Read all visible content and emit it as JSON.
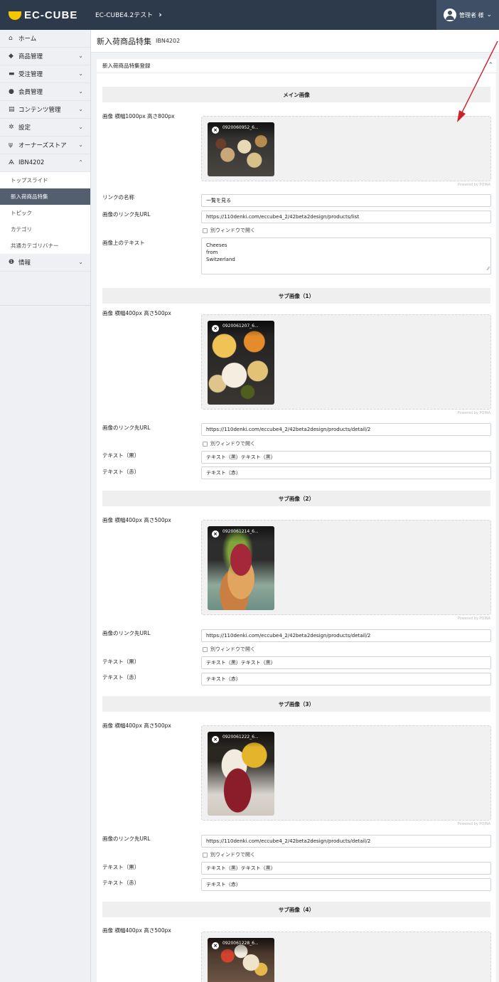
{
  "header": {
    "logo": "EC-CUBE",
    "shop_name": "EC-CUBE4.2テスト",
    "user_label": "管理者 様"
  },
  "sidebar": {
    "items": [
      {
        "label": "ホーム",
        "icon": "home-icon"
      },
      {
        "label": "商品管理",
        "icon": "cube-icon"
      },
      {
        "label": "受注管理",
        "icon": "cart-icon"
      },
      {
        "label": "会員管理",
        "icon": "users-icon"
      },
      {
        "label": "コンテンツ管理",
        "icon": "file-icon"
      },
      {
        "label": "設定",
        "icon": "gear-icon"
      },
      {
        "label": "オーナーズストア",
        "icon": "plug-icon"
      },
      {
        "label": "IBN4202",
        "icon": "plugin-icon"
      }
    ],
    "sub_items": [
      "トップスライド",
      "新入荷商品特集",
      "トピック",
      "カテゴリ",
      "共通カテゴリバナー"
    ],
    "info": {
      "label": "情報",
      "icon": "info-icon"
    }
  },
  "page": {
    "title": "新入荷商品特集",
    "code": "IBN4202",
    "card_title": "新入荷商品特集登録"
  },
  "main_image": {
    "section": "メイン画像",
    "image_label": "画像 横幅1000px 高さ800px",
    "file_name": "0920060952_6...",
    "file_size": "",
    "link_name_label": "リンクの名称",
    "link_name_value": "一覧を見る",
    "url_label": "画像のリンク先URL",
    "url_value": "https://110denki.com/eccube4_2/42beta2design/products/list",
    "new_window": "別ウィンドウで開く",
    "text_label": "画像上のテキスト",
    "text_value": "Cheeses\nfrom\nSwitzerland"
  },
  "powered_by": "Powered by PQINA",
  "sub_images": [
    {
      "section": "サブ画像（1）",
      "image_label": "画像 横幅400px 高さ500px",
      "file_name": "0920061207_6...",
      "url_label": "画像のリンク先URL",
      "url_value": "https://110denki.com/eccube4_2/42beta2design/products/detail/2",
      "new_window": "別ウィンドウで開く",
      "black_label": "テキスト（黒）",
      "black_value": "テキスト（黒）テキスト（黒）",
      "red_label": "テキスト（赤）",
      "red_value": "テキスト（赤）"
    },
    {
      "section": "サブ画像（2）",
      "image_label": "画像 横幅400px 高さ500px",
      "file_name": "0920061214_6...",
      "url_label": "画像のリンク先URL",
      "url_value": "https://110denki.com/eccube4_2/42beta2design/products/detail/2",
      "new_window": "別ウィンドウで開く",
      "black_label": "テキスト（黒）",
      "black_value": "テキスト（黒）テキスト（黒）",
      "red_label": "テキスト（赤）",
      "red_value": "テキスト（赤）"
    },
    {
      "section": "サブ画像（3）",
      "image_label": "画像 横幅400px 高さ500px",
      "file_name": "0920061222_6...",
      "url_label": "画像のリンク先URL",
      "url_value": "https://110denki.com/eccube4_2/42beta2design/products/detail/2",
      "new_window": "別ウィンドウで開く",
      "black_label": "テキスト（黒）",
      "black_value": "テキスト（黒）テキスト（黒）",
      "red_label": "テキスト（赤）",
      "red_value": "テキスト（赤）"
    },
    {
      "section": "サブ画像（4）",
      "image_label": "画像 横幅400px 高さ500px",
      "file_name": "0920061228_6..."
    }
  ],
  "colors": {
    "topbar": "#2d3a4b",
    "active_nav": "#535f6e",
    "annotation_arrow": "#d0202a"
  }
}
